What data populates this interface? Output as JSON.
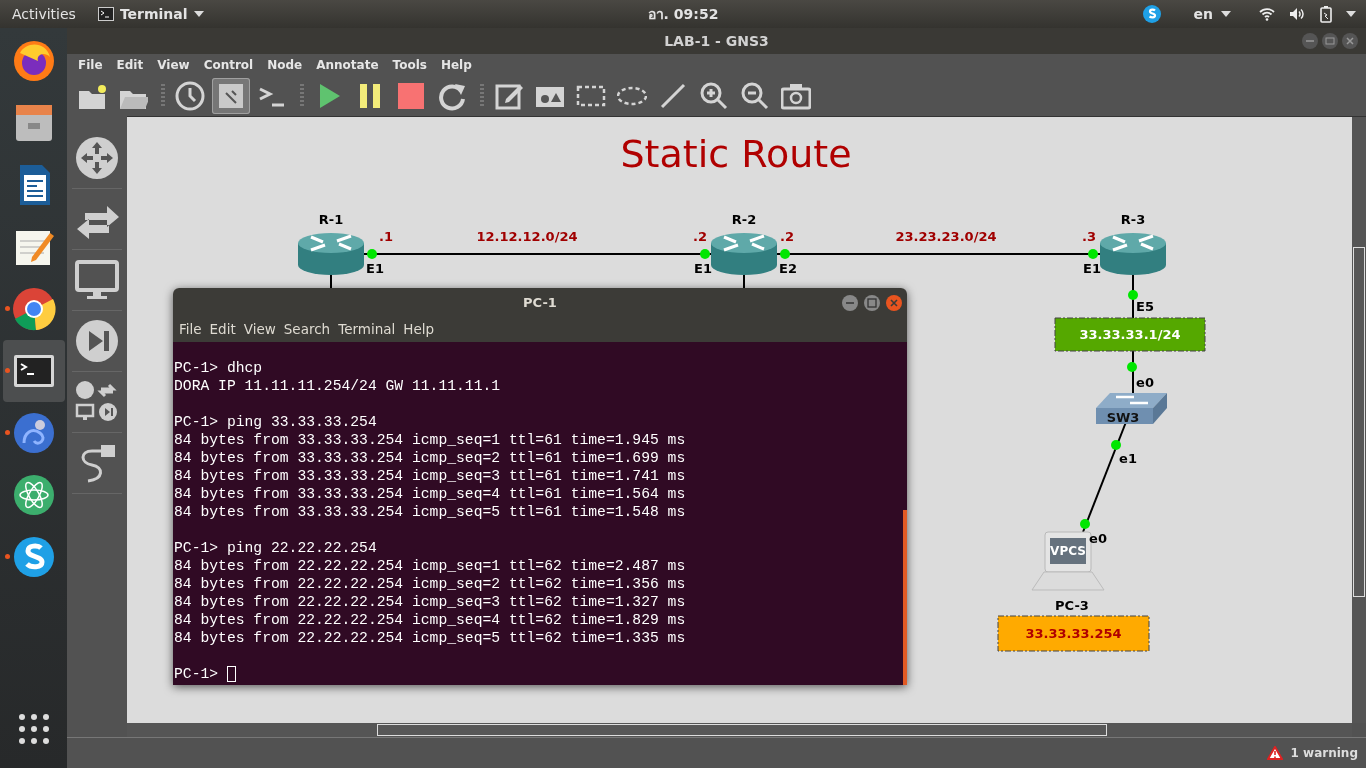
{
  "top_bar": {
    "activities": "Activities",
    "app_menu": "Terminal",
    "clock": "อา. 09:52",
    "language": "en"
  },
  "dock": [
    {
      "kind": "firefox",
      "running": false,
      "selected": false
    },
    {
      "kind": "files",
      "running": false,
      "selected": false
    },
    {
      "kind": "writer",
      "running": false,
      "selected": false
    },
    {
      "kind": "editor",
      "running": false,
      "selected": false
    },
    {
      "kind": "chrome",
      "running": true,
      "selected": false
    },
    {
      "kind": "terminal",
      "running": true,
      "selected": true
    },
    {
      "kind": "chameleon",
      "running": true,
      "selected": false
    },
    {
      "kind": "atom",
      "running": false,
      "selected": false
    },
    {
      "kind": "skype",
      "running": true,
      "selected": false
    },
    {
      "kind": "apps",
      "running": false,
      "selected": false
    }
  ],
  "window": {
    "title": "LAB-1 - GNS3"
  },
  "menu": [
    "File",
    "Edit",
    "View",
    "Control",
    "Node",
    "Annotate",
    "Tools",
    "Help"
  ],
  "toolbar": [
    {
      "kind": "new-project",
      "selected": false
    },
    {
      "kind": "open-project",
      "selected": false
    },
    {
      "kind": "sep"
    },
    {
      "kind": "snapshot",
      "selected": false
    },
    {
      "kind": "interface-labels",
      "selected": true
    },
    {
      "kind": "console",
      "selected": false
    },
    {
      "kind": "sep"
    },
    {
      "kind": "start",
      "selected": false
    },
    {
      "kind": "suspend",
      "selected": false
    },
    {
      "kind": "stop",
      "selected": false
    },
    {
      "kind": "reload",
      "selected": false
    },
    {
      "kind": "sep"
    },
    {
      "kind": "note",
      "selected": false
    },
    {
      "kind": "image",
      "selected": false
    },
    {
      "kind": "rectangle",
      "selected": false
    },
    {
      "kind": "ellipse",
      "selected": false
    },
    {
      "kind": "line",
      "selected": false
    },
    {
      "kind": "zoom-in",
      "selected": false
    },
    {
      "kind": "zoom-out",
      "selected": false
    },
    {
      "kind": "screenshot",
      "selected": false
    }
  ],
  "devices_panel": [
    {
      "kind": "routers"
    },
    {
      "kind": "switches"
    },
    {
      "kind": "end-devices"
    },
    {
      "kind": "security"
    },
    {
      "kind": "all-devices"
    },
    {
      "kind": "cable"
    }
  ],
  "topology": {
    "title": "Static Route",
    "nodes": [
      {
        "kind": "router",
        "name": "R-1"
      },
      {
        "kind": "router",
        "name": "R-2"
      },
      {
        "kind": "router",
        "name": "R-3"
      },
      {
        "kind": "switch",
        "name": "SW3"
      },
      {
        "kind": "vpcs",
        "name": "PC-3",
        "icon_text": "VPCS"
      }
    ],
    "links": [
      {
        "kind": "full",
        "subnet": "12.12.12.0/24",
        "ends": [
          {
            "port": "E1",
            "address": ".1"
          },
          {
            "port": "E1",
            "address": ".2"
          }
        ]
      },
      {
        "kind": "full",
        "subnet": "23.23.23.0/24",
        "ends": [
          {
            "port": "E2",
            "address": ".2"
          },
          {
            "port": "E1",
            "address": ".3"
          }
        ]
      },
      {
        "kind": "full",
        "ends": [
          {
            "port": "E5"
          },
          {
            "port": "e0"
          }
        ]
      },
      {
        "kind": "full",
        "ends": [
          {
            "port": "e1"
          },
          {
            "port": "e0"
          }
        ]
      },
      {
        "kind": "stub"
      },
      {
        "kind": "stub"
      }
    ],
    "notes": [
      {
        "kind": "gateway",
        "text": "33.33.33.1/24",
        "color": "#55a800"
      },
      {
        "kind": "host",
        "text": "33.33.33.254",
        "color": "#ffaa00"
      }
    ]
  },
  "terminal": {
    "title": "PC-1",
    "menu": [
      "File",
      "Edit",
      "View",
      "Search",
      "Terminal",
      "Help"
    ],
    "blocks": [
      [
        "PC-1> dhcp",
        "DORA IP 11.11.11.254/24 GW 11.11.11.1"
      ],
      [
        "PC-1> ping 33.33.33.254",
        "84 bytes from 33.33.33.254 icmp_seq=1 ttl=61 time=1.945 ms",
        "84 bytes from 33.33.33.254 icmp_seq=2 ttl=61 time=1.699 ms",
        "84 bytes from 33.33.33.254 icmp_seq=3 ttl=61 time=1.741 ms",
        "84 bytes from 33.33.33.254 icmp_seq=4 ttl=61 time=1.564 ms",
        "84 bytes from 33.33.33.254 icmp_seq=5 ttl=61 time=1.548 ms"
      ],
      [
        "PC-1> ping 22.22.22.254",
        "84 bytes from 22.22.22.254 icmp_seq=1 ttl=62 time=2.487 ms",
        "84 bytes from 22.22.22.254 icmp_seq=2 ttl=62 time=1.356 ms",
        "84 bytes from 22.22.22.254 icmp_seq=3 ttl=62 time=1.327 ms",
        "84 bytes from 22.22.22.254 icmp_seq=4 ttl=62 time=1.829 ms",
        "84 bytes from 22.22.22.254 icmp_seq=5 ttl=62 time=1.335 ms"
      ]
    ],
    "prompt": "PC-1>"
  },
  "status_bar": {
    "warnings": "1 warning"
  }
}
